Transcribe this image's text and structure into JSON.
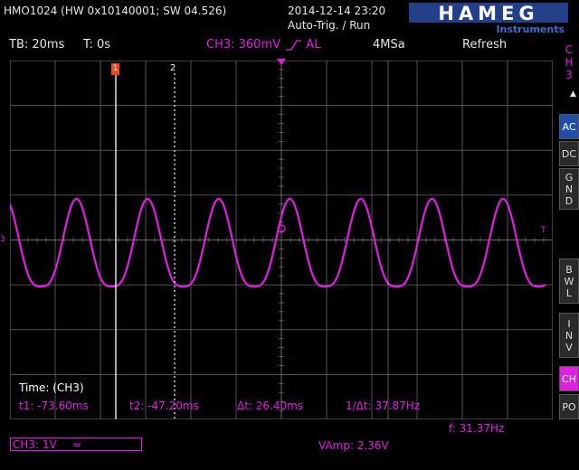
{
  "header": {
    "device": "HMO1024 (HW 0x10140001; SW 04.526)",
    "datetime": "2014-12-14 23:20",
    "mode": "Auto-Trig. / Run",
    "brand": "HAMEG",
    "brand_sub": "Instruments"
  },
  "status": {
    "timebase": "TB: 20ms",
    "trigger_time": "T: 0s",
    "channel_trigger": "CH3: 360mV",
    "trigger_suffix": "AL",
    "sample_rate": "4MSa",
    "acq_mode": "Refresh"
  },
  "side": {
    "channel_label": [
      "C",
      "H",
      "3"
    ],
    "ac": "AC",
    "dc": "DC",
    "gnd": [
      "G",
      "N",
      "D"
    ],
    "bwl": [
      "B",
      "W",
      "L"
    ],
    "inv": [
      "I",
      "N",
      "V"
    ],
    "ch": "CH",
    "po": "PO"
  },
  "cursor": {
    "title": "Time: (CH3)",
    "t1": "t1: -73.60ms",
    "t2": "t2: -47.20ms",
    "dt": "Δt: 26.40ms",
    "inv_dt": "1/Δt: 37.87Hz",
    "marker1": "1",
    "marker2": "2"
  },
  "footer": {
    "channel": "CH3: 1V",
    "channel_coupling_icon": "ac-coupling-icon",
    "freq": "f: 31.37Hz",
    "vamp": "VAmp: 2.36V"
  },
  "markers": {
    "ch3_left": "3",
    "trig_right": "T"
  },
  "colors": {
    "channel": "#e020e0",
    "cursor": "#ffffff",
    "grid": "#6a6a6a",
    "marker": "#e84a1c",
    "active_button": "#1f4fa8"
  },
  "chart_data": {
    "type": "line",
    "series": [
      {
        "values": "rectified periodic waveform"
      }
    ],
    "x_divisions": 12,
    "y_divisions": 8,
    "grid": true
  }
}
